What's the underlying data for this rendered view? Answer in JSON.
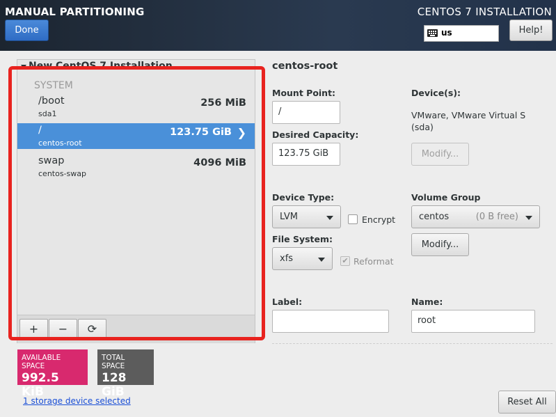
{
  "header": {
    "title": "MANUAL PARTITIONING",
    "done_label": "Done",
    "install_title": "CENTOS 7 INSTALLATION",
    "keyboard_layout": "us",
    "help_label": "Help!"
  },
  "tree": {
    "header": "New CentOS 7 Installation",
    "section": "SYSTEM",
    "partitions": [
      {
        "mount": "/boot",
        "device": "sda1",
        "size": "256 MiB",
        "selected": false
      },
      {
        "mount": "/",
        "device": "centos-root",
        "size": "123.75 GiB",
        "selected": true
      },
      {
        "mount": "swap",
        "device": "centos-swap",
        "size": "4096 MiB",
        "selected": false
      }
    ],
    "toolbar": {
      "add": "+",
      "remove": "−",
      "refresh": "⟳"
    }
  },
  "space": {
    "available_label": "AVAILABLE SPACE",
    "available_value": "992.5 KiB",
    "total_label": "TOTAL SPACE",
    "total_value": "128 GiB",
    "available_color": "#d8296e",
    "total_color": "#5c5c5c"
  },
  "storage_link": "1 storage device selected",
  "details": {
    "title": "centos-root",
    "mount_point_label": "Mount Point:",
    "mount_point_value": "/",
    "capacity_label": "Desired Capacity:",
    "capacity_value": "123.75 GiB",
    "devices_label": "Device(s):",
    "devices_line1": "VMware, VMware Virtual S",
    "devices_line2": "(sda)",
    "modify_devices_label": "Modify...",
    "device_type_label": "Device Type:",
    "device_type_value": "LVM",
    "encrypt_label": "Encrypt",
    "volume_group_label": "Volume Group",
    "volume_group_value": "centos",
    "volume_group_free": "(0 B free)",
    "modify_vg_label": "Modify...",
    "file_system_label": "File System:",
    "file_system_value": "xfs",
    "reformat_label": "Reformat",
    "label_label": "Label:",
    "label_value": "",
    "name_label": "Name:",
    "name_value": "root"
  },
  "reset_label": "Reset All",
  "accent_color": "#4a90d9",
  "highlight_color": "#e8231f"
}
